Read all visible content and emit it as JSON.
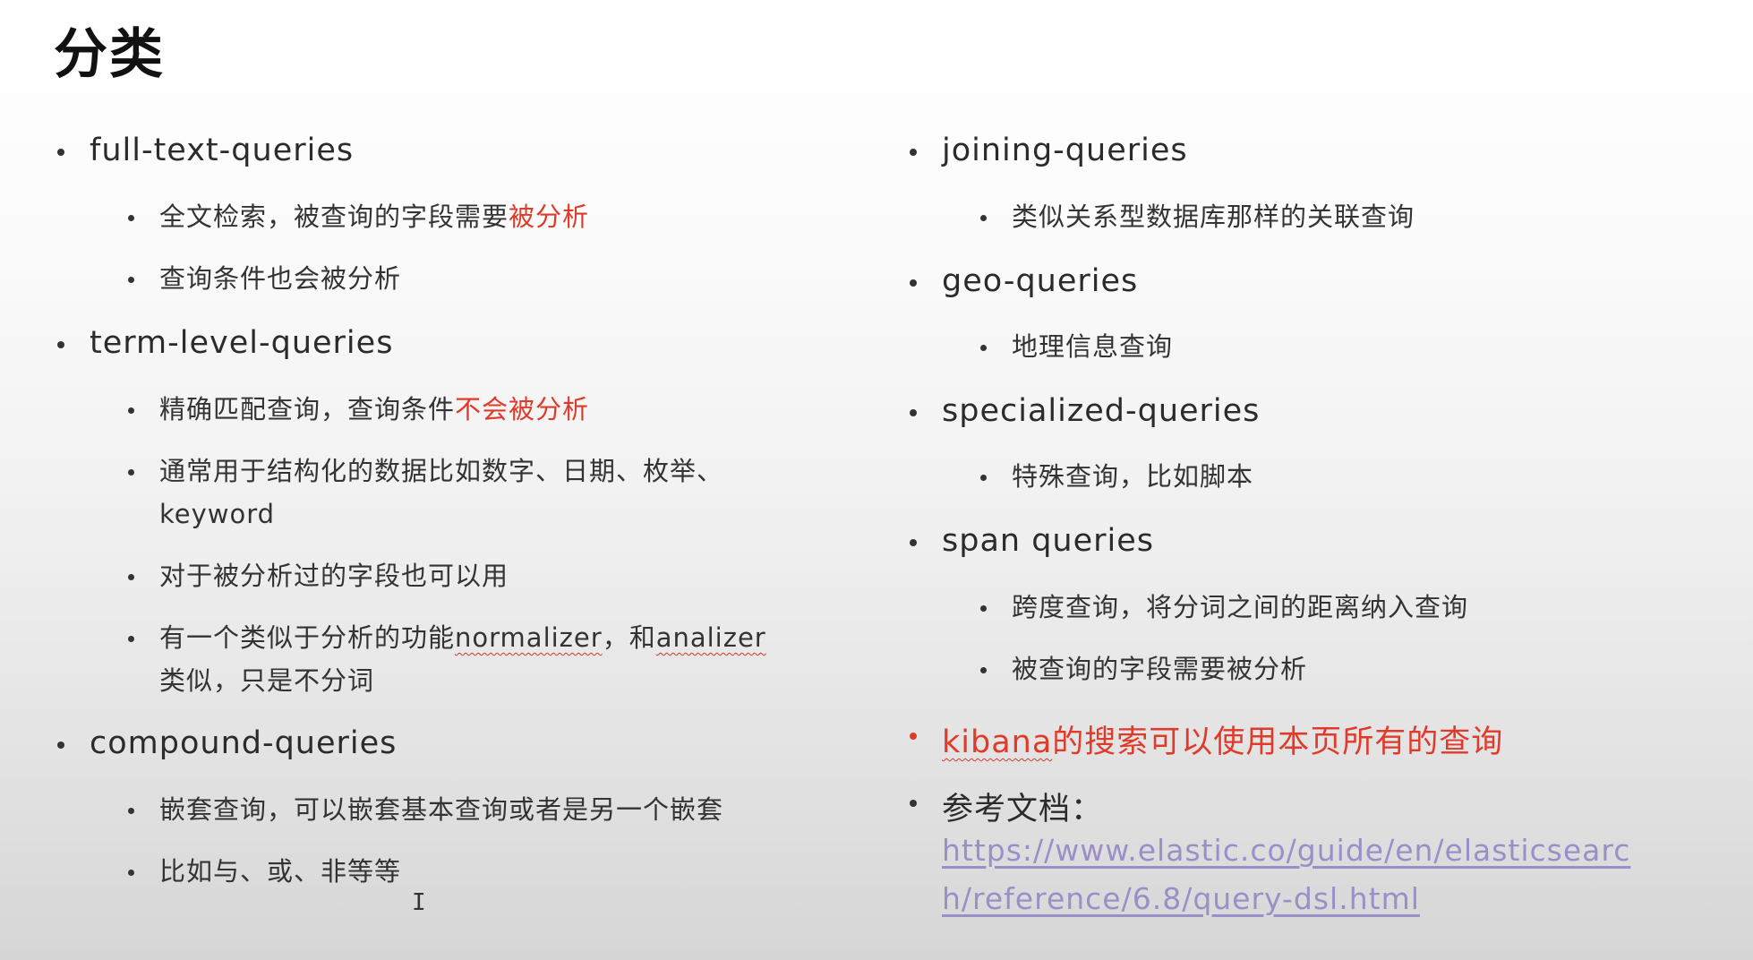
{
  "title": "分类",
  "left": {
    "full_text": {
      "heading": "full-text-queries",
      "items": [
        {
          "pre": "全文检索，被查询的字段需要",
          "red": "被分析"
        },
        {
          "text": "查询条件也会被分析"
        }
      ]
    },
    "term_level": {
      "heading": "term-level-queries",
      "items": [
        {
          "pre": "精确匹配查询，查询条件",
          "red": "不会被分析"
        },
        {
          "line1": "通常用于结构化的数据比如数字、日期、枚举、",
          "line2": "keyword"
        },
        {
          "text": "对于被分析过的字段也可以用"
        },
        {
          "pre": "有一个类似于分析的功能",
          "word1": "normalizer",
          "mid": "，和",
          "word2": "analizer",
          "line2": "类似，只是不分词"
        }
      ]
    },
    "compound": {
      "heading": "compound-queries",
      "items": [
        {
          "text": "嵌套查询，可以嵌套基本查询或者是另一个嵌套"
        },
        {
          "text": "比如与、或、非等等"
        }
      ]
    }
  },
  "right": {
    "joining": {
      "heading": "joining-queries",
      "items": [
        {
          "text": "类似关系型数据库那样的关联查询"
        }
      ]
    },
    "geo": {
      "heading": "geo-queries",
      "items": [
        {
          "text": "地理信息查询"
        }
      ]
    },
    "specialized": {
      "heading": "specialized-queries",
      "items": [
        {
          "text": "特殊查询，比如脚本"
        }
      ]
    },
    "span": {
      "heading": "span queries",
      "items": [
        {
          "text": "跨度查询，将分词之间的距离纳入查询"
        },
        {
          "text": "被查询的字段需要被分析"
        }
      ]
    },
    "kibana": {
      "word": "kibana",
      "rest": "的搜索可以使用本页所有的查询"
    },
    "reference": {
      "label": "参考文档：",
      "url_line1": "https://www.elastic.co/guide/en/elasticsearc",
      "url_line2": "h/reference/6.8/query-dsl.html"
    }
  },
  "colors": {
    "accent_red": "#e03a2a",
    "link": "#9b8fc8",
    "text": "#2b2b2b"
  },
  "icons": {
    "cursor": "text-cursor-icon"
  }
}
